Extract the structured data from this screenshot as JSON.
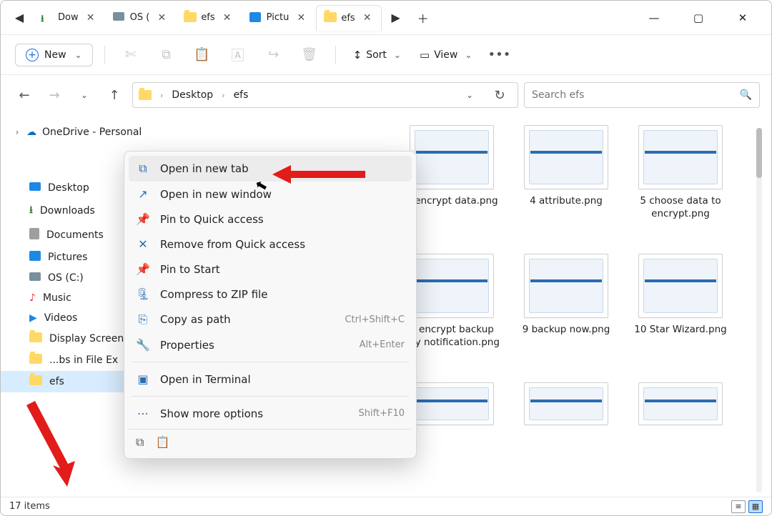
{
  "tabs": [
    {
      "label": "Dow",
      "kind": "download"
    },
    {
      "label": "OS (",
      "kind": "drive"
    },
    {
      "label": "efs",
      "kind": "folder"
    },
    {
      "label": "Pictu",
      "kind": "pictures"
    },
    {
      "label": "efs",
      "kind": "folder",
      "active": true
    }
  ],
  "toolbar": {
    "new_label": "New",
    "sort_label": "Sort",
    "view_label": "View"
  },
  "breadcrumb": [
    "Desktop",
    "efs"
  ],
  "search_placeholder": "Search efs",
  "sidebar": {
    "top": "OneDrive - Personal",
    "items": [
      {
        "label": "Desktop",
        "color": "#1e88e5",
        "kind": "desktop"
      },
      {
        "label": "Downloads",
        "color": "#2e7d32",
        "kind": "download"
      },
      {
        "label": "Documents",
        "color": "#757575",
        "kind": "docs"
      },
      {
        "label": "Pictures",
        "color": "#1e88e5",
        "kind": "pictures"
      },
      {
        "label": "OS (C:)",
        "color": "#546e7a",
        "kind": "drive"
      },
      {
        "label": "Music",
        "color": "#e53935",
        "kind": "music"
      },
      {
        "label": "Videos",
        "color": "#1e88e5",
        "kind": "videos"
      },
      {
        "label": "Display Screen",
        "color": "#ffd968",
        "kind": "folder"
      },
      {
        "label": "...bs in File Ex",
        "color": "#ffd968",
        "kind": "folder"
      },
      {
        "label": "efs",
        "color": "#ffd968",
        "kind": "folder",
        "selected": true
      }
    ]
  },
  "context_menu": {
    "items": [
      {
        "label": "Open in new tab",
        "icon": "⧉",
        "hover": true
      },
      {
        "label": "Open in new window",
        "icon": "↗"
      },
      {
        "label": "Pin to Quick access",
        "icon": "📌"
      },
      {
        "label": "Remove from Quick access",
        "icon": "✕"
      },
      {
        "label": "Pin to Start",
        "icon": "📌"
      },
      {
        "label": "Compress to ZIP file",
        "icon": "🗜"
      },
      {
        "label": "Copy as path",
        "icon": "⎘",
        "shortcut": "Ctrl+Shift+C"
      },
      {
        "label": "Properties",
        "icon": "🔧",
        "shortcut": "Alt+Enter"
      },
      {
        "sep": true
      },
      {
        "label": "Open in Terminal",
        "icon": "▣"
      },
      {
        "sep": true
      },
      {
        "label": "Show more options",
        "icon": "⋯",
        "shortcut": "Shift+F10"
      }
    ]
  },
  "files": [
    "3 encrypt data.png",
    "4 attribute.png",
    "5 choose data to encrypt.png",
    "8 encrypt backup key notification.png",
    "9 backup now.png",
    "10 Star Wizard.png"
  ],
  "status": {
    "count": "17 items"
  }
}
